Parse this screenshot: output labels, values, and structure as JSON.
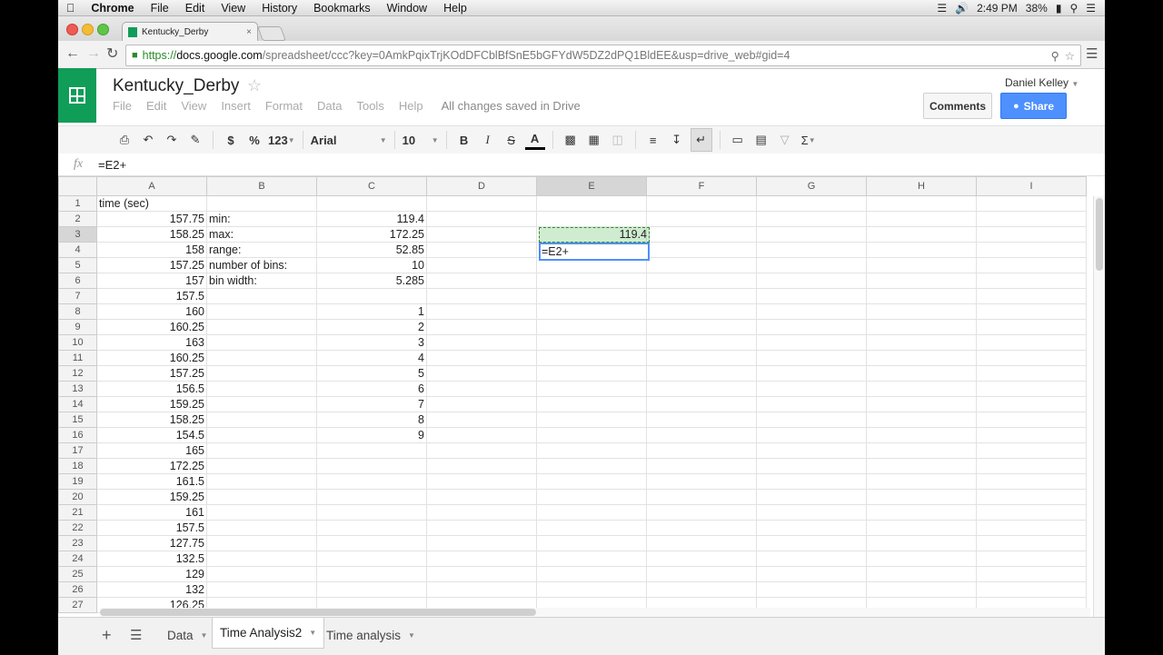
{
  "menubar": {
    "app": "Chrome",
    "items": [
      "File",
      "Edit",
      "View",
      "History",
      "Bookmarks",
      "Window",
      "Help"
    ],
    "time": "2:49 PM",
    "battery": "38%"
  },
  "browser": {
    "tab_title": "Kentucky_Derby",
    "url_scheme": "https://",
    "url_host": "docs.google.com",
    "url_rest": "/spreadsheet/ccc?key=0AmkPqixTrjKOdDFCblBfSnE5bGFYdW5DZ2dPQ1BldEE&usp=drive_web#gid=4"
  },
  "doc": {
    "title": "Kentucky_Derby",
    "menus": [
      "File",
      "Edit",
      "View",
      "Insert",
      "Format",
      "Data",
      "Tools",
      "Help"
    ],
    "save_status": "All changes saved in Drive",
    "user": "Daniel Kelley",
    "comments_label": "Comments",
    "share_label": "Share"
  },
  "toolbar": {
    "currency": "$",
    "percent": "%",
    "number_format": "123",
    "font": "Arial",
    "font_size": "10",
    "bold": "B",
    "italic": "I",
    "strike": "S",
    "text_color": "A",
    "sum": "Σ"
  },
  "formula_bar": {
    "fx": "fx",
    "value": "=E2+"
  },
  "columns": [
    "A",
    "B",
    "C",
    "D",
    "E",
    "F",
    "G",
    "H",
    "I"
  ],
  "rows": [
    {
      "n": "1",
      "a": "time (sec)",
      "b": "",
      "c": ""
    },
    {
      "n": "2",
      "a": "157.75",
      "b": "min:",
      "c": "119.4"
    },
    {
      "n": "3",
      "a": "158.25",
      "b": "max:",
      "c": "172.25"
    },
    {
      "n": "4",
      "a": "158",
      "b": "range:",
      "c": "52.85"
    },
    {
      "n": "5",
      "a": "157.25",
      "b": "number of bins:",
      "c": "10"
    },
    {
      "n": "6",
      "a": "157",
      "b": "bin width:",
      "c": "5.285"
    },
    {
      "n": "7",
      "a": "157.5",
      "b": "",
      "c": ""
    },
    {
      "n": "8",
      "a": "160",
      "b": "",
      "c": "1"
    },
    {
      "n": "9",
      "a": "160.25",
      "b": "",
      "c": "2"
    },
    {
      "n": "10",
      "a": "163",
      "b": "",
      "c": "3"
    },
    {
      "n": "11",
      "a": "160.25",
      "b": "",
      "c": "4"
    },
    {
      "n": "12",
      "a": "157.25",
      "b": "",
      "c": "5"
    },
    {
      "n": "13",
      "a": "156.5",
      "b": "",
      "c": "6"
    },
    {
      "n": "14",
      "a": "159.25",
      "b": "",
      "c": "7"
    },
    {
      "n": "15",
      "a": "158.25",
      "b": "",
      "c": "8"
    },
    {
      "n": "16",
      "a": "154.5",
      "b": "",
      "c": "9"
    },
    {
      "n": "17",
      "a": "165",
      "b": "",
      "c": ""
    },
    {
      "n": "18",
      "a": "172.25",
      "b": "",
      "c": ""
    },
    {
      "n": "19",
      "a": "161.5",
      "b": "",
      "c": ""
    },
    {
      "n": "20",
      "a": "159.25",
      "b": "",
      "c": ""
    },
    {
      "n": "21",
      "a": "161",
      "b": "",
      "c": ""
    },
    {
      "n": "22",
      "a": "157.5",
      "b": "",
      "c": ""
    },
    {
      "n": "23",
      "a": "127.75",
      "b": "",
      "c": ""
    },
    {
      "n": "24",
      "a": "132.5",
      "b": "",
      "c": ""
    },
    {
      "n": "25",
      "a": "129",
      "b": "",
      "c": ""
    },
    {
      "n": "26",
      "a": "132",
      "b": "",
      "c": ""
    },
    {
      "n": "27",
      "a": "126.25",
      "b": "",
      "c": ""
    }
  ],
  "cells": {
    "e2": "119.4",
    "e3_edit": "=E2+"
  },
  "sheets": {
    "tabs": [
      "Data",
      "Time Analysis2",
      "Time analysis"
    ],
    "active_index": 1
  },
  "colors": {
    "sheets_green": "#0f9d58",
    "share_blue": "#4d90fe",
    "selection_blue": "#4d90fe"
  }
}
